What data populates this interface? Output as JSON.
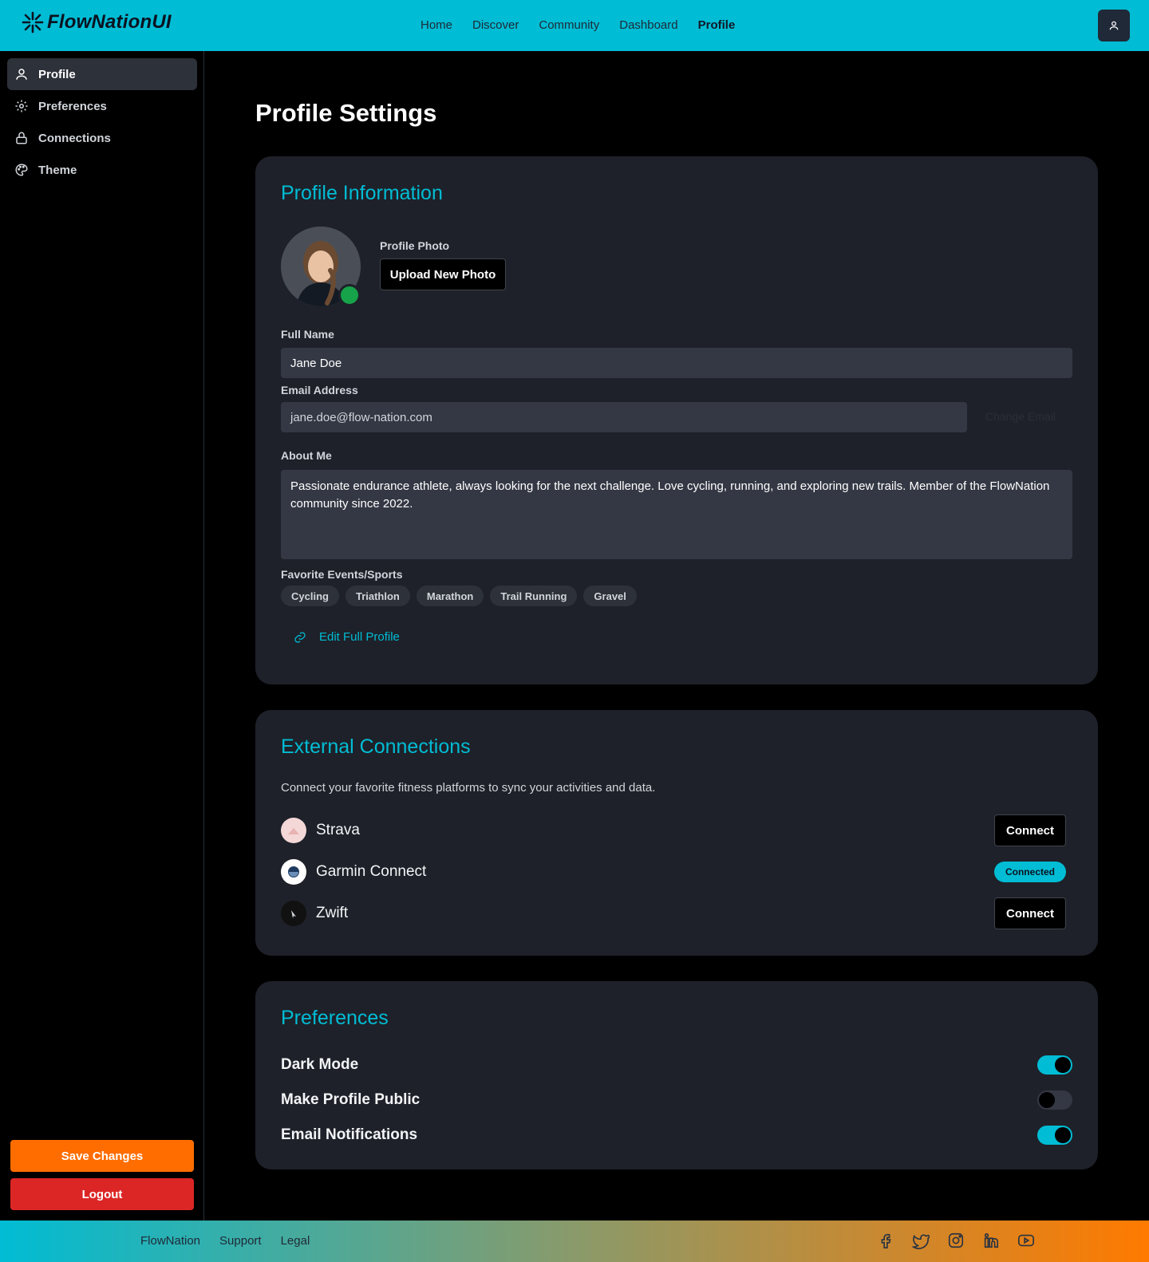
{
  "brand": {
    "name": "FlowNationUI"
  },
  "nav": {
    "items": [
      "Home",
      "Discover",
      "Community",
      "Dashboard",
      "Profile"
    ],
    "active": "Profile"
  },
  "sidebar": {
    "items": [
      {
        "label": "Profile",
        "icon": "user-icon"
      },
      {
        "label": "Preferences",
        "icon": "gear-icon"
      },
      {
        "label": "Connections",
        "icon": "lock-icon"
      },
      {
        "label": "Theme",
        "icon": "palette-icon"
      }
    ],
    "save_label": "Save Changes",
    "logout_label": "Logout"
  },
  "page": {
    "title": "Profile Settings"
  },
  "profile": {
    "title": "Profile Information",
    "photo_label": "Profile Photo",
    "upload_label": "Upload New Photo",
    "full_name_label": "Full Name",
    "full_name_value": "Jane Doe",
    "email_label": "Email Address",
    "email_value": "jane.doe@flow-nation.com",
    "change_email_label": "Change Email",
    "about_label": "About Me",
    "about_value": "Passionate endurance athlete, always looking for the next challenge. Love cycling, running, and exploring new trails. Member of the FlowNation community since 2022.",
    "favorites_label": "Favorite Events/Sports",
    "favorites": [
      "Cycling",
      "Triathlon",
      "Marathon",
      "Trail Running",
      "Gravel"
    ],
    "edit_link_label": "Edit Full Profile"
  },
  "connections": {
    "title": "External Connections",
    "description": "Connect your favorite fitness platforms to sync your activities and data.",
    "items": [
      {
        "name": "Strava",
        "status": "Connect",
        "connected": false
      },
      {
        "name": "Garmin Connect",
        "status": "Connected",
        "connected": true
      },
      {
        "name": "Zwift",
        "status": "Connect",
        "connected": false
      }
    ]
  },
  "preferences": {
    "title": "Preferences",
    "items": [
      {
        "label": "Dark Mode",
        "enabled": true
      },
      {
        "label": "Make Profile Public",
        "enabled": false
      },
      {
        "label": "Email Notifications",
        "enabled": true
      }
    ]
  },
  "footer": {
    "links": [
      "FlowNation",
      "Support",
      "Legal"
    ],
    "social": [
      "facebook-icon",
      "twitter-icon",
      "instagram-icon",
      "linkedin-icon",
      "youtube-icon"
    ]
  },
  "colors": {
    "accent": "#00bcd4",
    "save": "#ff6d00",
    "logout": "#dc2626",
    "card": "#1e2129",
    "online": "#16a34a"
  }
}
